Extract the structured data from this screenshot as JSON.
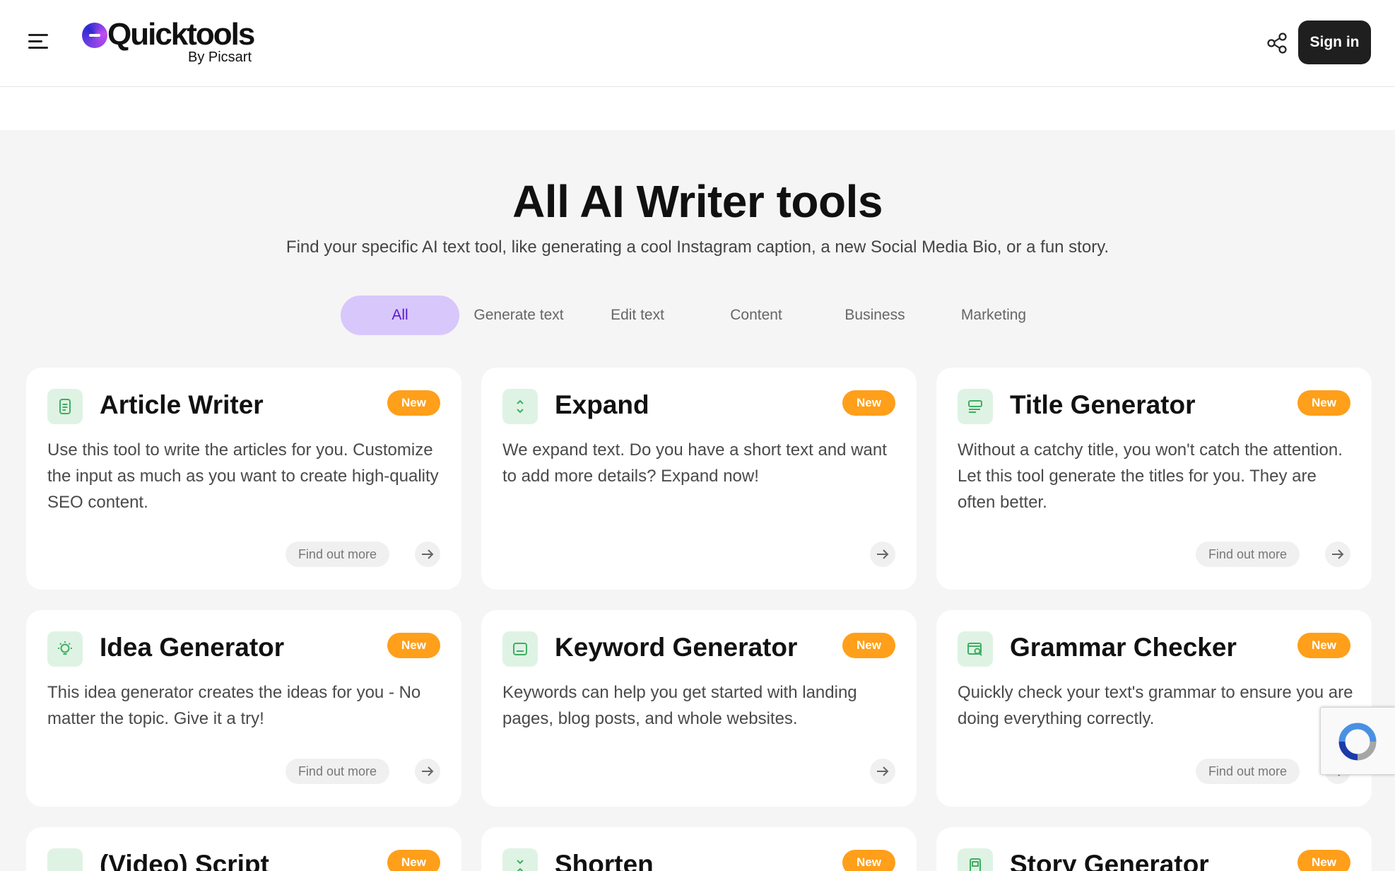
{
  "header": {
    "logo_text": "Quicktools",
    "logo_sub": "By Picsart",
    "sign_in_label": "Sign in"
  },
  "main": {
    "title": "All AI Writer tools",
    "subtitle": "Find your specific AI text tool, like generating a cool Instagram caption, a new Social Media Bio, or a fun story.",
    "tabs": [
      {
        "label": "All",
        "active": true
      },
      {
        "label": "Generate text",
        "active": false
      },
      {
        "label": "Edit text",
        "active": false
      },
      {
        "label": "Content",
        "active": false
      },
      {
        "label": "Business",
        "active": false
      },
      {
        "label": "Marketing",
        "active": false
      }
    ],
    "find_out_more_label": "Find out more",
    "cards": [
      {
        "title": "Article Writer",
        "badge": "New",
        "icon": "document-icon",
        "description": "Use this tool to write the articles for you. Customize the input as much as you want to create high-quality SEO content.",
        "has_find_out_more": true
      },
      {
        "title": "Expand",
        "badge": "New",
        "icon": "expand-icon",
        "description": "We expand text. Do you have a short text and want to add more details? Expand now!",
        "has_find_out_more": false
      },
      {
        "title": "Title Generator",
        "badge": "New",
        "icon": "title-icon",
        "description": "Without a catchy title, you won't catch the attention. Let this tool generate the titles for you. They are often better.",
        "has_find_out_more": true
      },
      {
        "title": "Idea Generator",
        "badge": "New",
        "icon": "lightbulb-icon",
        "description": "This idea generator creates the ideas for you - No matter the topic. Give it a try!",
        "has_find_out_more": true
      },
      {
        "title": "Keyword Generator",
        "badge": "New",
        "icon": "keyword-icon",
        "description": "Keywords can help you get started with landing pages, blog posts, and whole websites.",
        "has_find_out_more": false
      },
      {
        "title": "Grammar Checker",
        "badge": "New",
        "icon": "grammar-check-icon",
        "description": "Quickly check your text's grammar to ensure you are doing everything correctly.",
        "has_find_out_more": true
      },
      {
        "title": "(Video) Script",
        "badge": "New",
        "icon": "video-script-icon",
        "description": "",
        "has_find_out_more": false
      },
      {
        "title": "Shorten",
        "badge": "New",
        "icon": "shorten-icon",
        "description": "",
        "has_find_out_more": false
      },
      {
        "title": "Story Generator",
        "badge": "New",
        "icon": "story-icon",
        "description": "",
        "has_find_out_more": false
      }
    ]
  },
  "colors": {
    "accent_tab_bg": "#d8c7fb",
    "accent_tab_text": "#5a1ad1",
    "badge": "#ff9f1a",
    "icon_bg": "#dff3e4",
    "icon_fg": "#3fae62",
    "sign_in_bg": "#1f1f1f"
  }
}
